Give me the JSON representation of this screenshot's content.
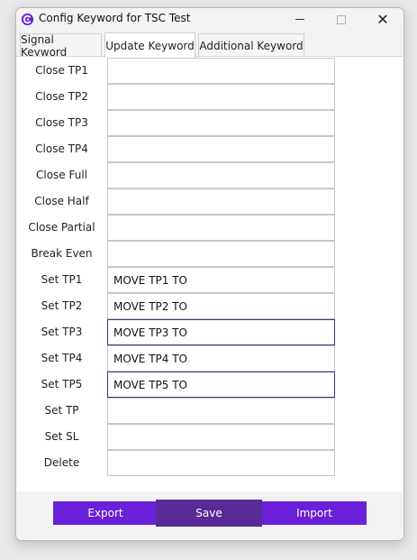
{
  "window": {
    "title": "Config Keyword for TSC Test",
    "close_glyph": "✕"
  },
  "tabs": [
    {
      "label": "Signal Keyword",
      "active": false
    },
    {
      "label": "Update Keyword",
      "active": true
    },
    {
      "label": "Additional Keyword",
      "active": false
    }
  ],
  "rows": [
    {
      "label": "Close TP1",
      "value": ""
    },
    {
      "label": "Close TP2",
      "value": ""
    },
    {
      "label": "Close TP3",
      "value": ""
    },
    {
      "label": "Close TP4",
      "value": ""
    },
    {
      "label": "Close Full",
      "value": ""
    },
    {
      "label": "Close Half",
      "value": ""
    },
    {
      "label": "Close Partial",
      "value": ""
    },
    {
      "label": "Break Even",
      "value": ""
    },
    {
      "label": "Set TP1",
      "value": "MOVE TP1 TO"
    },
    {
      "label": "Set TP2",
      "value": "MOVE TP2 TO"
    },
    {
      "label": "Set TP3",
      "value": "MOVE TP3 TO"
    },
    {
      "label": "Set TP4",
      "value": "MOVE TP4 TO"
    },
    {
      "label": "Set TP5",
      "value": "MOVE TP5 TO"
    },
    {
      "label": "Set TP",
      "value": ""
    },
    {
      "label": "Set SL",
      "value": ""
    },
    {
      "label": "Delete",
      "value": ""
    }
  ],
  "buttons": {
    "export_label": "Export",
    "save_label": "Save",
    "import_label": "Import"
  },
  "colors": {
    "accent": "#6a1fd8",
    "save_pressed": "#5a2a96",
    "focus_border": "#4b2a83"
  }
}
